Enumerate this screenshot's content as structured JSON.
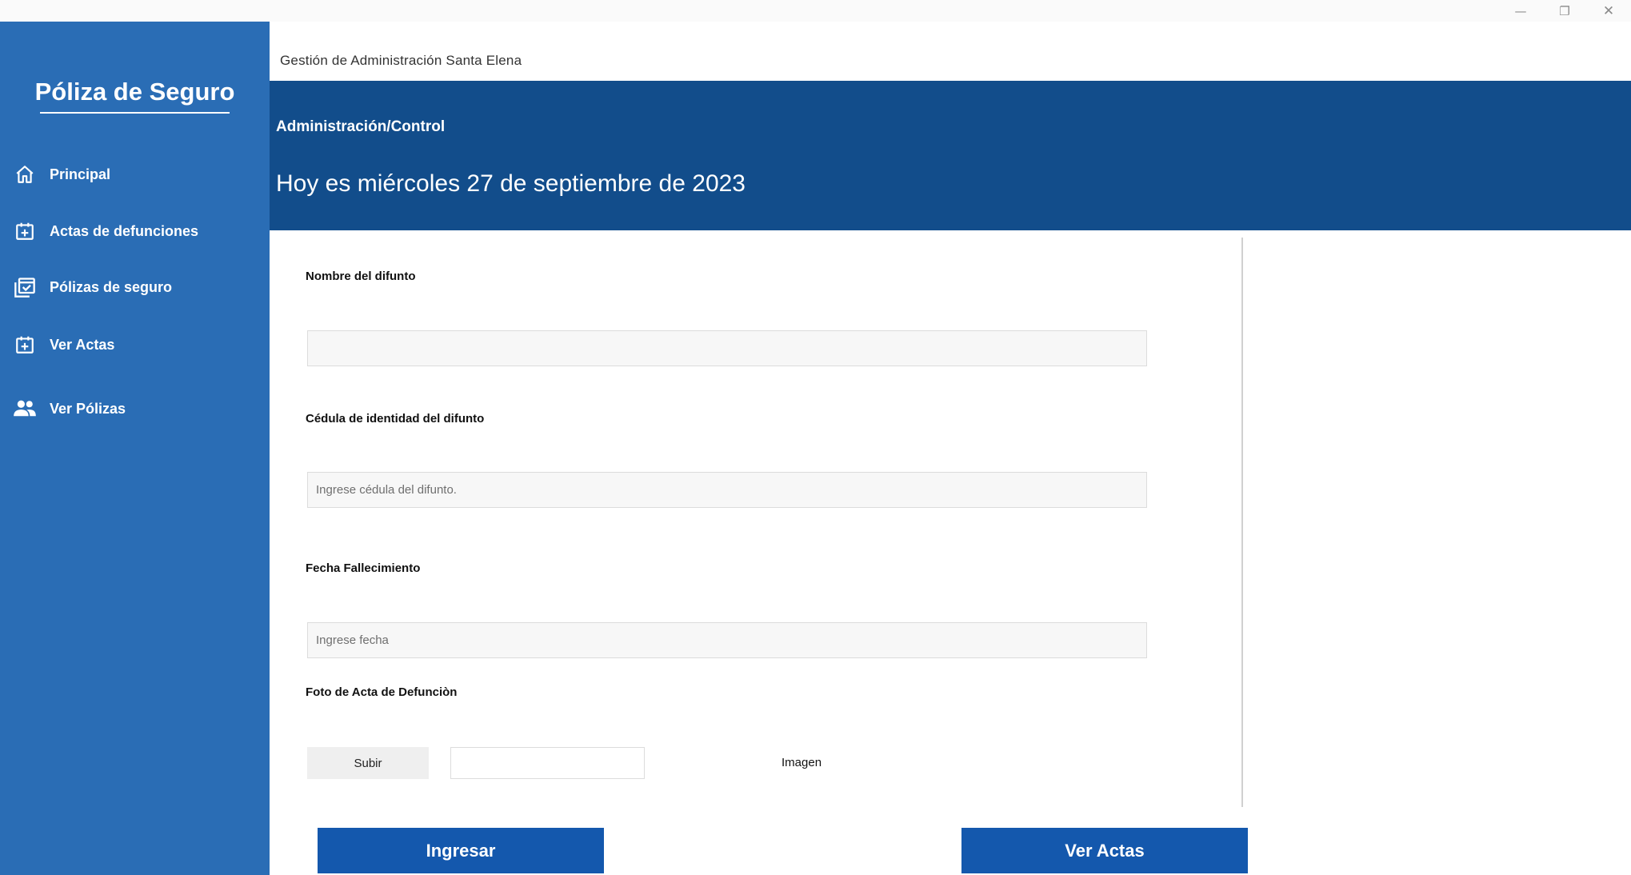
{
  "window": {
    "minimize_glyph": "—",
    "maximize_glyph": "❐",
    "close_glyph": "✕"
  },
  "sidebar": {
    "brand": "Póliza de Seguro",
    "background_color": "#2a6db5",
    "items": [
      {
        "label": "Principal",
        "icon": "home-icon"
      },
      {
        "label": "Actas de defunciones",
        "icon": "calendar-add-icon"
      },
      {
        "label": "Pólizas de seguro",
        "icon": "calendar-check-icon"
      },
      {
        "label": "Ver Actas",
        "icon": "calendar-add-icon"
      },
      {
        "label": "Ver Pólizas",
        "icon": "people-icon"
      }
    ]
  },
  "header": {
    "app_title": "Gestión de Administración Santa Elena",
    "breadcrumb": "Administración/Control",
    "date_text": "Hoy es miércoles 27 de septiembre de 2023",
    "banner_color": "#124d8b"
  },
  "form": {
    "name_label": "Nombre del difunto",
    "name_value": "",
    "name_placeholder": "",
    "cedula_label": "Cédula de identidad del difunto",
    "cedula_placeholder": "Ingrese cédula del difunto.",
    "fecha_label": "Fecha Fallecimiento",
    "fecha_placeholder": "Ingrese fecha",
    "foto_label": "Foto de Acta de Defunciòn",
    "upload_button": "Subir",
    "image_label": "Imagen"
  },
  "actions": {
    "submit_label": "Ingresar",
    "view_label": "Ver Actas",
    "button_color": "#1458ad"
  }
}
